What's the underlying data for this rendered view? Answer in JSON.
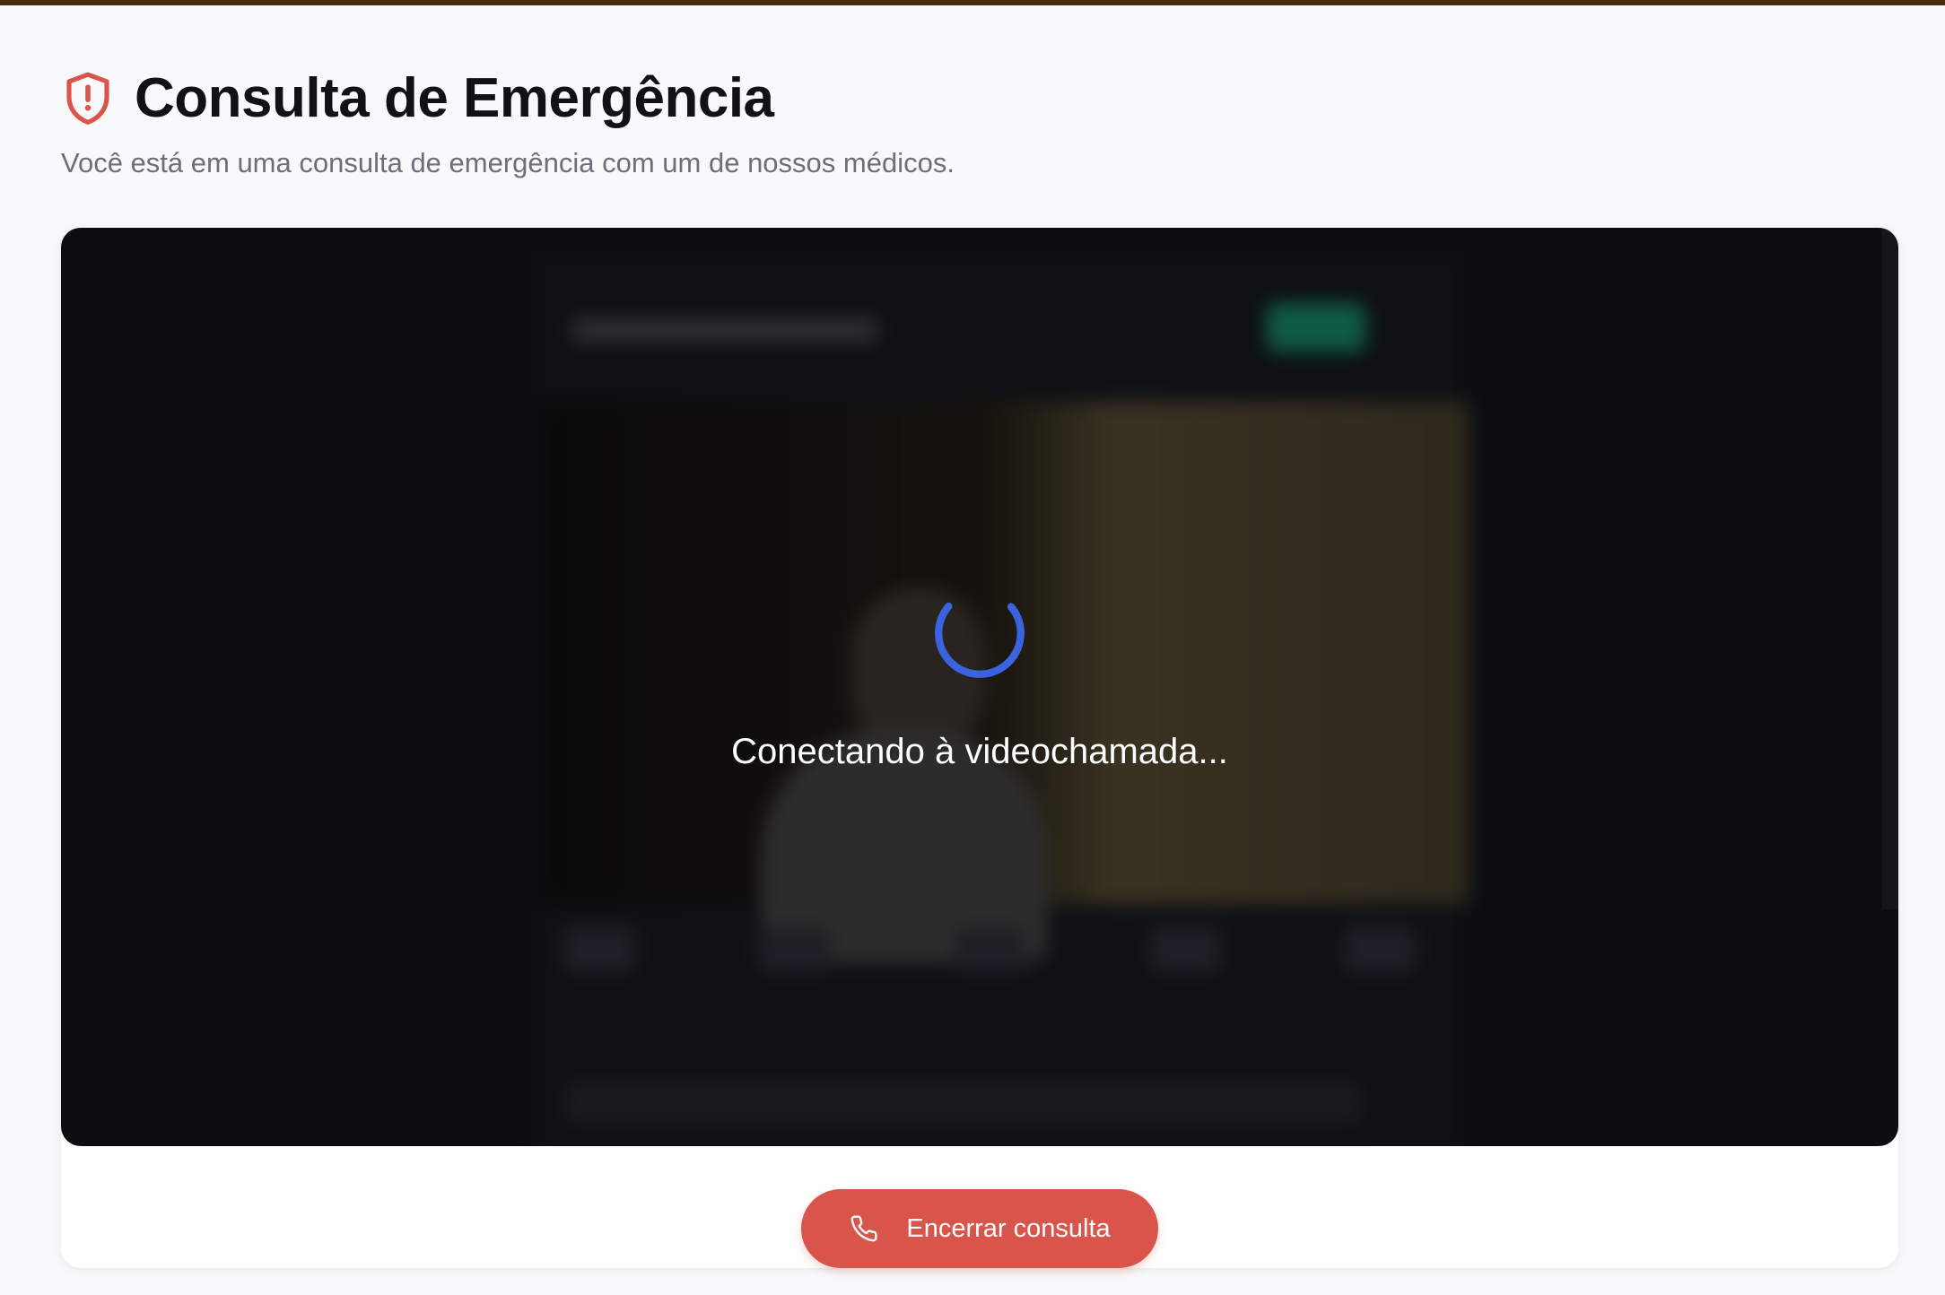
{
  "header": {
    "title": "Consulta de Emergência",
    "subtitle": "Você está em uma consulta de emergência com um de nossos médicos.",
    "icon": "shield-alert-icon"
  },
  "video": {
    "status_text": "Conectando à videochamada..."
  },
  "actions": {
    "end_label": "Encerrar consulta",
    "end_icon": "phone-icon"
  },
  "colors": {
    "accent_red": "#d9544a",
    "spinner_blue": "#3b63e0",
    "video_bg": "#0b0d12"
  }
}
